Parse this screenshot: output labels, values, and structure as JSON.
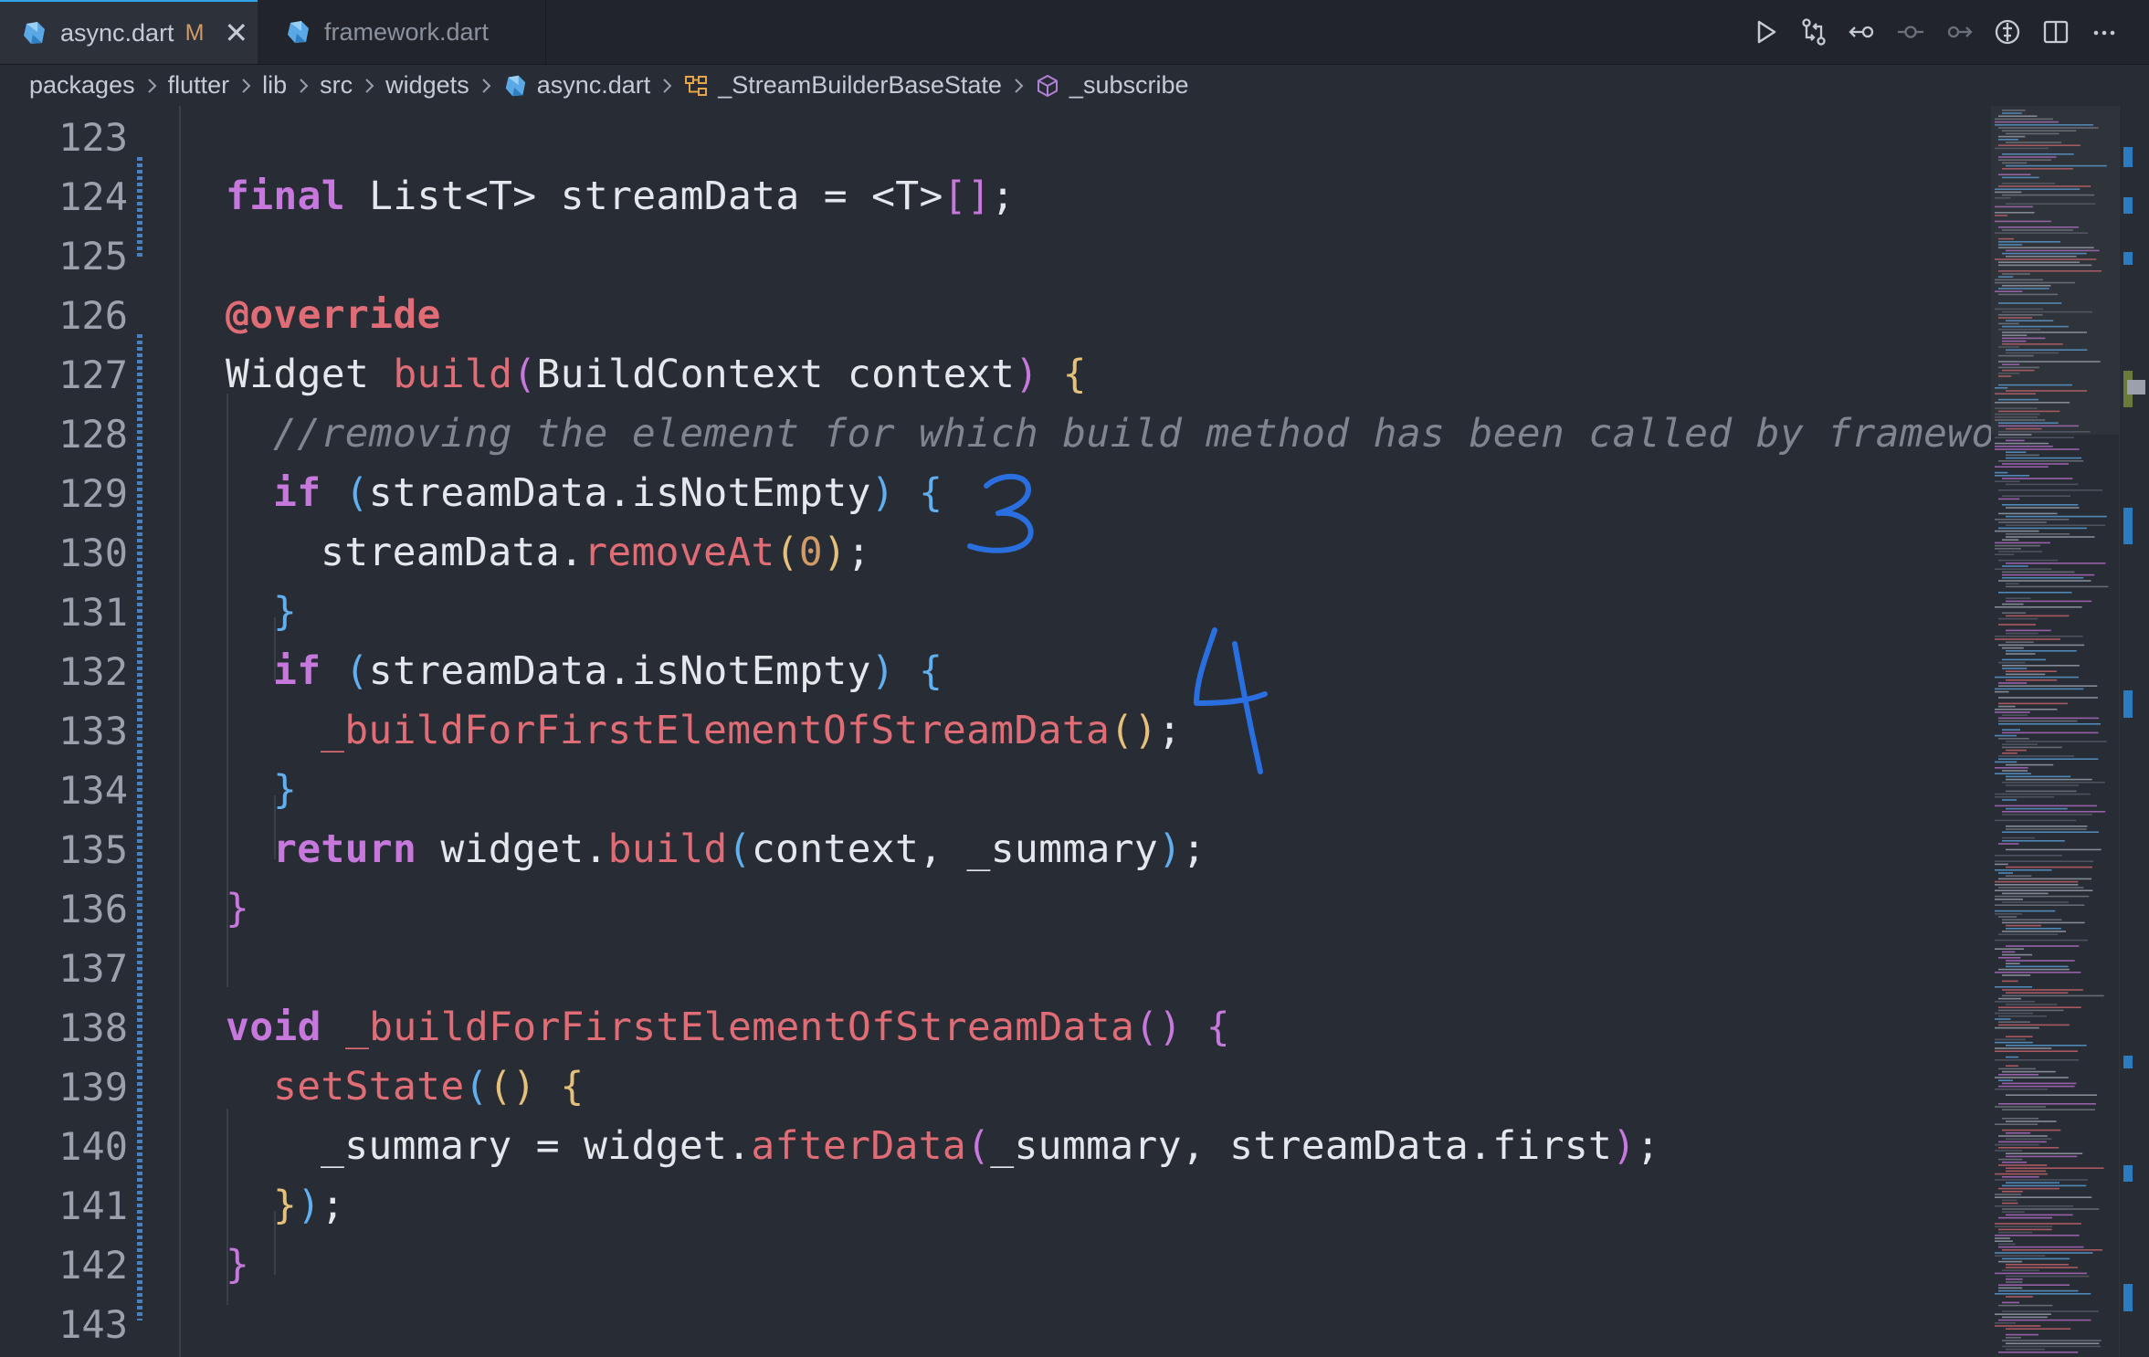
{
  "tabs": [
    {
      "name": "async.dart",
      "modified": "M",
      "close": "✕"
    },
    {
      "name": "framework.dart"
    }
  ],
  "breadcrumb": [
    "packages",
    "flutter",
    "lib",
    "src",
    "widgets",
    "async.dart",
    "_StreamBuilderBaseState",
    "_subscribe"
  ],
  "toolbar_icons": [
    "run-icon",
    "source-control-compare-icon",
    "go-back-change-icon",
    "previous-change-icon",
    "next-change-icon",
    "open-changes-icon",
    "split-editor-icon",
    "more-actions-icon"
  ],
  "line_numbers": [
    "123",
    "124",
    "125",
    "126",
    "127",
    "128",
    "129",
    "130",
    "131",
    "132",
    "133",
    "134",
    "135",
    "136",
    "137",
    "138",
    "139",
    "140",
    "141",
    "142",
    "143"
  ],
  "code": {
    "l124": {
      "kw": "final",
      "rest": " List<T> streamData = <T>",
      "open": "[",
      "close": "]",
      "end": ";"
    },
    "l126": {
      "ann": "@override"
    },
    "l127": {
      "type": "Widget ",
      "fn": "build",
      "p1": "(",
      "args": "BuildContext context",
      "p2": ")",
      "sp": " ",
      "brace": "{"
    },
    "l128": {
      "comment": "//removing the element for which build method has been called by framework"
    },
    "l129": {
      "kw": "if",
      "sp": " ",
      "p1": "(",
      "cond": "streamData.isNotEmpty",
      "p2": ")",
      "sp2": " ",
      "brace": "{"
    },
    "l130": {
      "obj": "streamData.",
      "fn": "removeAt",
      "p1": "(",
      "num": "0",
      "p2": ")",
      "end": ";"
    },
    "l131": {
      "brace": "}"
    },
    "l132": {
      "kw": "if",
      "sp": " ",
      "p1": "(",
      "cond": "streamData.isNotEmpty",
      "p2": ")",
      "sp2": " ",
      "brace": "{"
    },
    "l133": {
      "fn": "_buildForFirstElementOfStreamData",
      "p": "()",
      "end": ";"
    },
    "l134": {
      "brace": "}"
    },
    "l135": {
      "kw": "return",
      "obj": " widget.",
      "fn": "build",
      "p1": "(",
      "args": "context, _summary",
      "p2": ")",
      "end": ";"
    },
    "l136": {
      "brace": "}"
    },
    "l138": {
      "kw": "void",
      "sp": " ",
      "fn": "_buildForFirstElementOfStreamData",
      "p": "()",
      "sp2": " ",
      "brace": "{"
    },
    "l139": {
      "fn": "setState",
      "p1": "(",
      "p": "()",
      "sp": " ",
      "brace": "{"
    },
    "l140": {
      "lhs": "_summary = widget.",
      "fn": "afterData",
      "p1": "(",
      "args": "_summary, streamData.first",
      "p2": ")",
      "end": ";"
    },
    "l141": {
      "brace": "}",
      "p2": ")",
      "end": ";"
    },
    "l142": {
      "brace": "}"
    }
  },
  "annotations": [
    "3",
    "4"
  ],
  "colors": {
    "keyword": "#c678dd",
    "function": "#e06c75",
    "comment": "#7f848e",
    "bracket_blue": "#61afef",
    "bracket_yellow": "#e5c07b",
    "ink": "#2a6fe0"
  }
}
